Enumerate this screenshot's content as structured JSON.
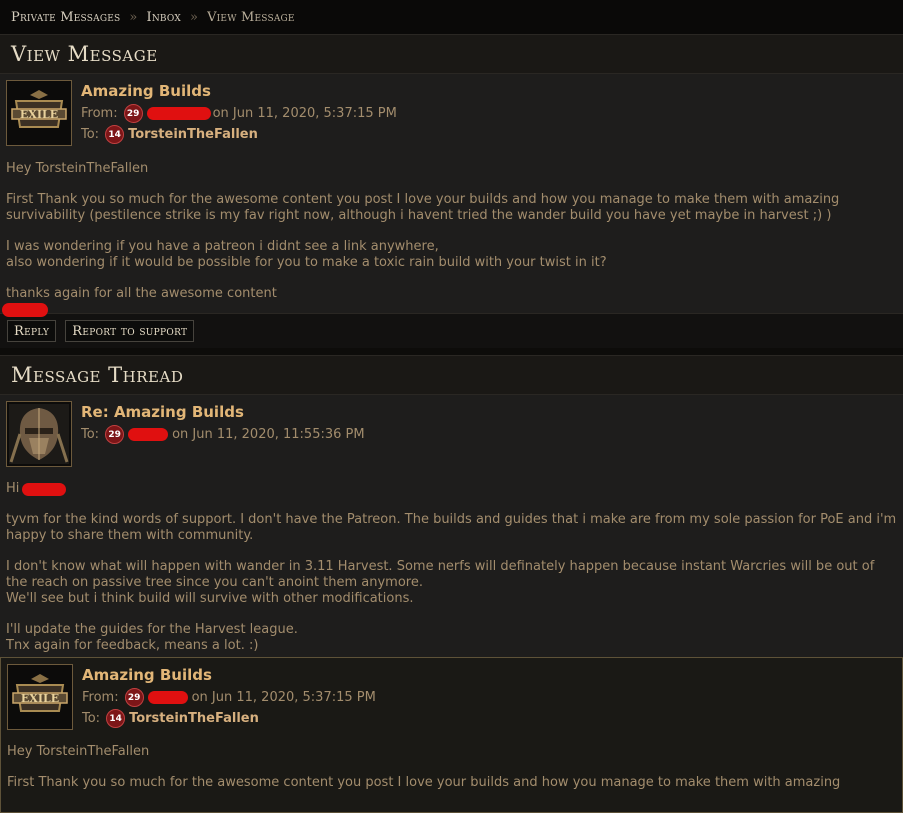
{
  "breadcrumb": {
    "items": [
      "Private Messages",
      "Inbox",
      "View Message"
    ]
  },
  "view_message": {
    "title": "View Message",
    "subject": "Amazing Builds",
    "from_label": "From:",
    "from_level": "29",
    "date": "on Jun 11, 2020, 5:37:15 PM",
    "to_label": "To:",
    "to_level": "14",
    "to_name": "TorsteinTheFallen",
    "body": [
      "Hey TorsteinTheFallen",
      "First Thank you so much for the awesome content you post I love your builds and how you manage to make them with amazing survivability (pestilence strike is my fav right now, although i havent tried the wander build you have yet maybe in harvest ;) )",
      "I was wondering if you have a patreon i didnt see a link anywhere,\nalso wondering if it would be possible for you to make a toxic rain build with your twist in it?",
      "thanks again for all the awesome content"
    ]
  },
  "actions": {
    "reply": "Reply",
    "report": "Report to support"
  },
  "thread": {
    "title": "Message Thread",
    "reply": {
      "subject": "Re: Amazing Builds",
      "to_label": "To:",
      "to_level": "29",
      "date": "on Jun 11, 2020, 11:55:36 PM",
      "greeting": "Hi",
      "body": [
        "tyvm for the kind words of support. I don't have the Patreon. The builds and guides that i make are from my sole passion for PoE and i'm happy to share them with community.",
        "I don't know what will happen with wander in 3.11 Harvest. Some nerfs will definately happen because instant Warcries will be out of the reach on passive tree since you can't anoint them anymore.\nWe'll see but i think build will survive with other modifications.",
        "I'll update the guides for the Harvest league.\nTnx again for feedback, means a lot. :)"
      ]
    },
    "original": {
      "subject": "Amazing Builds",
      "from_label": "From:",
      "from_level": "29",
      "date": "on Jun 11, 2020, 5:37:15 PM",
      "to_label": "To:",
      "to_level": "14",
      "to_name": "TorsteinTheFallen",
      "body": [
        "Hey TorsteinTheFallen",
        "First Thank you so much for the awesome content you post I love your builds and how you manage to make them with amazing"
      ]
    }
  },
  "colors": {
    "accent": "#e2b677",
    "level_badge": "#7d1618",
    "redaction": "#e01010"
  }
}
